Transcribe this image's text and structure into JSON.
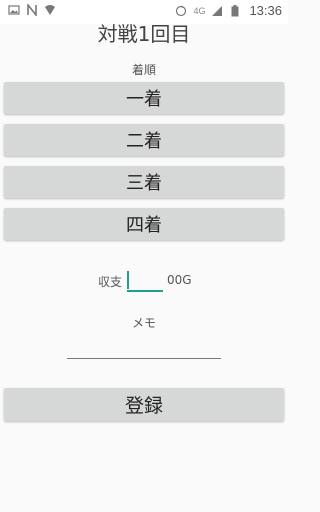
{
  "statusbar": {
    "icons": [
      "image-icon",
      "n-icon",
      "wifi-icon",
      "sync-icon",
      "signal-4g-icon",
      "battery-icon"
    ],
    "network": "4G",
    "time": "13:36"
  },
  "title": "対戦1回目",
  "order": {
    "label": "着順",
    "options": [
      "一着",
      "二着",
      "三着",
      "四着"
    ]
  },
  "income": {
    "label": "収支",
    "value": "",
    "suffix": "00G"
  },
  "memo": {
    "label": "メモ",
    "value": ""
  },
  "register_label": "登録",
  "colors": {
    "accent": "#1f9e96",
    "button_bg": "#d6d7d7",
    "background": "#fafafa"
  }
}
